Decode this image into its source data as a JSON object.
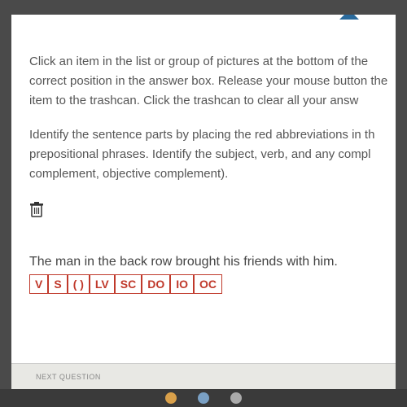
{
  "instructions": "Click an item in the list or group of pictures at the bottom of the correct position in the answer box. Release your mouse button the item to the trashcan. Click the trashcan to clear all your answ",
  "question": "Identify the sentence parts by placing the red abbreviations in th prepositional phrases. Identify the subject, verb, and any compl complement, objective complement).",
  "sentence": "The man in the back row brought his friends with him.",
  "tiles": [
    "V",
    "S",
    "( )",
    "LV",
    "SC",
    "DO",
    "IO",
    "OC"
  ],
  "footer": {
    "next": "NEXT QUESTION"
  }
}
